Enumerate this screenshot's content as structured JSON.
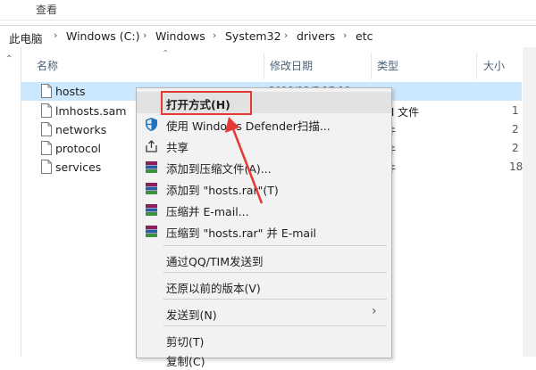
{
  "ribbon": {
    "view_tab": "查看"
  },
  "breadcrumb": {
    "items": [
      "此电脑",
      "Windows (C:)",
      "Windows",
      "System32",
      "drivers",
      "etc"
    ]
  },
  "columns": {
    "name": "名称",
    "date": "修改日期",
    "type": "类型",
    "size": "大小"
  },
  "files": [
    {
      "name": "hosts",
      "date": "2019/12/7 17:19",
      "type": "",
      "selected": true
    },
    {
      "name": "lmhosts.sam",
      "date": "",
      "type": "M 文件"
    },
    {
      "name": "networks",
      "date": "",
      "type": "件"
    },
    {
      "name": "protocol",
      "date": "",
      "type": "件"
    },
    {
      "name": "services",
      "date": "",
      "type": "件"
    }
  ],
  "size_fragments": [
    "1",
    "2",
    "2",
    "18"
  ],
  "context_menu": {
    "items": [
      {
        "label": "打开方式(H)",
        "icon": "none"
      },
      {
        "label": "使用 Windows Defender扫描...",
        "icon": "defender-shield-icon"
      },
      {
        "label": "共享",
        "icon": "share-icon"
      },
      {
        "label": "添加到压缩文件(A)...",
        "icon": "winrar-icon"
      },
      {
        "label": "添加到 \"hosts.rar\"(T)",
        "icon": "winrar-icon"
      },
      {
        "label": "压缩并 E-mail...",
        "icon": "winrar-icon"
      },
      {
        "label": "压缩到 \"hosts.rar\" 并 E-mail",
        "icon": "winrar-icon"
      },
      {
        "label": "通过QQ/TIM发送到",
        "icon": "none"
      },
      {
        "label": "还原以前的版本(V)",
        "icon": "none"
      },
      {
        "label": "发送到(N)",
        "icon": "none",
        "submenu": true
      },
      {
        "label": "剪切(T)",
        "icon": "none"
      },
      {
        "label": "复制(C)",
        "icon": "none"
      }
    ]
  },
  "colors": {
    "highlight_box": "#e53935",
    "selection": "#cce8ff",
    "menu_bg": "#f2f2f2"
  }
}
